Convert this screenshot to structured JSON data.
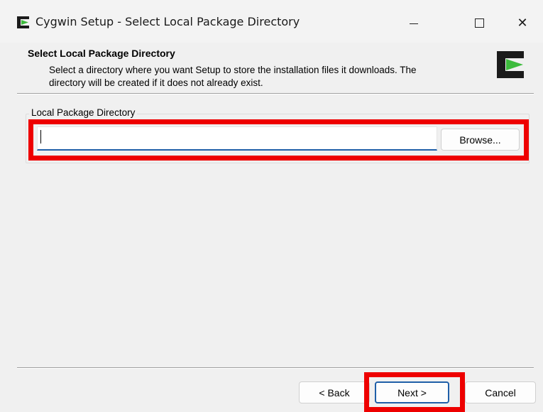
{
  "window": {
    "title": "Cygwin Setup - Select Local Package Directory",
    "controls": {
      "minimize": "minimize",
      "maximize": "maximize",
      "close": "✕"
    }
  },
  "header": {
    "title": "Select Local Package Directory",
    "description": "Select a directory where you want Setup to store the installation files it downloads.  The directory will be created if it does not already exist."
  },
  "group": {
    "label": "Local Package Directory",
    "input_value": "",
    "browse_label": "Browse..."
  },
  "buttons": {
    "back": "< Back",
    "next": "Next >",
    "cancel": "Cancel"
  },
  "colors": {
    "highlight": "#ee0000",
    "focus_accent": "#1f5fa8",
    "cygwin_green": "#3dbb3d"
  }
}
